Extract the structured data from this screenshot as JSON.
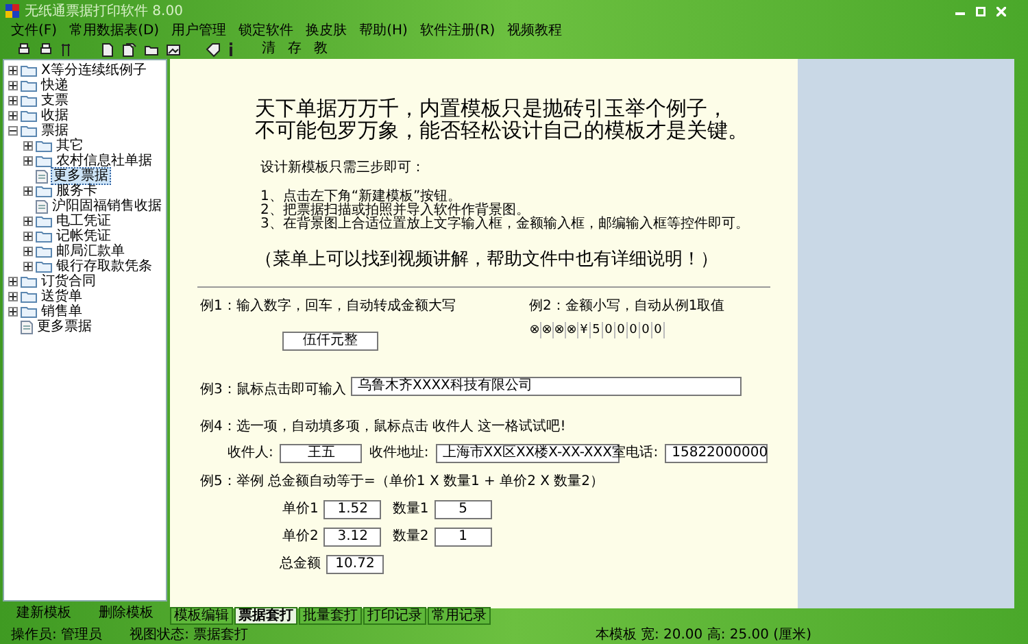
{
  "window": {
    "title": "无纸通票据打印软件 8.00"
  },
  "menu": [
    "文件(F)",
    "常用数据表(D)",
    "用户管理",
    "锁定软件",
    "换皮肤",
    "帮助(H)",
    "软件注册(R)",
    "视频教程"
  ],
  "toolbar": {
    "text_buttons": [
      "清",
      "存",
      "教"
    ]
  },
  "tree": [
    {
      "label": "X等分连续纸例子",
      "kind": "folder",
      "expanded": false,
      "selected": false
    },
    {
      "label": "快递",
      "kind": "folder",
      "expanded": false,
      "selected": false
    },
    {
      "label": "支票",
      "kind": "folder",
      "expanded": false,
      "selected": false
    },
    {
      "label": "收据",
      "kind": "folder",
      "expanded": false,
      "selected": false
    },
    {
      "label": "票据",
      "kind": "folder",
      "expanded": true,
      "selected": false,
      "children": [
        {
          "label": "其它",
          "kind": "folder",
          "expanded": false,
          "selected": false
        },
        {
          "label": "农村信息社单据",
          "kind": "folder",
          "expanded": false,
          "selected": false
        },
        {
          "label": "更多票据",
          "kind": "document",
          "selected": true
        },
        {
          "label": "服务卡",
          "kind": "folder",
          "expanded": false,
          "selected": false
        },
        {
          "label": "沪阳固福销售收据",
          "kind": "document",
          "selected": false
        },
        {
          "label": "电工凭证",
          "kind": "folder",
          "expanded": false,
          "selected": false
        },
        {
          "label": "记帐凭证",
          "kind": "folder",
          "expanded": false,
          "selected": false
        },
        {
          "label": "邮局汇款单",
          "kind": "folder",
          "expanded": false,
          "selected": false
        },
        {
          "label": "银行存取款凭条",
          "kind": "folder",
          "expanded": false,
          "selected": false
        }
      ]
    },
    {
      "label": "订货合同",
      "kind": "folder",
      "expanded": false,
      "selected": false
    },
    {
      "label": "送货单",
      "kind": "folder",
      "expanded": false,
      "selected": false
    },
    {
      "label": "销售单",
      "kind": "folder",
      "expanded": false,
      "selected": false
    },
    {
      "label": "更多票据",
      "kind": "document",
      "selected": false
    }
  ],
  "template_buttons": [
    "建新模板",
    "删除模板"
  ],
  "canvas": {
    "headline": [
      "天下单据万万千，内置模板只是抛砖引玉举个例子，",
      "不可能包罗万象，能否轻松设计自己的模板才是关键。"
    ],
    "intro": "设计新模板只需三步即可：",
    "steps": [
      "1、点击左下角“新建模板”按钮。",
      "2、把票据扫描或拍照并导入软件作背景图。",
      "3、在背景图上合适位置放上文字输入框，金额输入框，邮编输入框等控件即可。"
    ],
    "note": "（菜单上可以找到视频讲解，帮助文件中也有详细说明！）",
    "example1": {
      "label": "例1：输入数字，回车，自动转成金额大写",
      "value": "伍仟元整"
    },
    "example2": {
      "label": "例2：金额小写，自动从例1取值",
      "digits": [
        "⊗",
        "⊗",
        "⊗",
        "⊗",
        "¥",
        "5",
        "0",
        "0",
        "0",
        "0",
        "0"
      ]
    },
    "example3": {
      "label": "例3：鼠标点击即可输入",
      "value": "乌鲁木齐XXXX科技有限公司"
    },
    "example4": {
      "label": "例4：选一项，自动填多项，鼠标点击 收件人 这一格试试吧!",
      "fields": [
        {
          "label": "收件人:",
          "value": "王五"
        },
        {
          "label": "收件地址:",
          "value": "上海市XX区XX楼X-XX-XXX室"
        },
        {
          "label": "电话:",
          "value": "15822000000"
        }
      ]
    },
    "example5": {
      "label": "例5：举例 总金额自动等于=（单价1 X 数量1 + 单价2 X 数量2）",
      "rows": [
        [
          {
            "label": "单价1",
            "value": "1.52"
          },
          {
            "label": "数量1",
            "value": "5"
          }
        ],
        [
          {
            "label": "单价2",
            "value": "3.12"
          },
          {
            "label": "数量2",
            "value": "1"
          }
        ]
      ],
      "total": {
        "label": "总金额",
        "value": "10.72"
      }
    }
  },
  "tabs": [
    {
      "label": "模板编辑",
      "selected": false
    },
    {
      "label": "票据套打",
      "selected": true
    },
    {
      "label": "批量套打",
      "selected": false
    },
    {
      "label": "打印记录",
      "selected": false
    },
    {
      "label": "常用记录",
      "selected": false
    }
  ],
  "status_bar": {
    "operator": "操作员: 管理员",
    "view_state": "视图状态: 票据套打",
    "template_size": "本模板 宽: 20.00 高: 25.00 (厘米)"
  }
}
